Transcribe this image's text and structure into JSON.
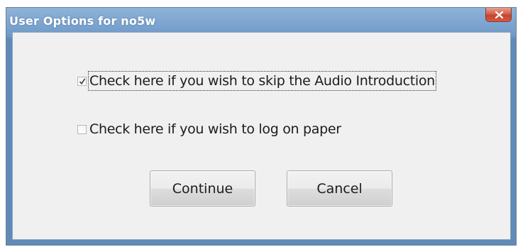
{
  "window": {
    "title": "User Options for no5w"
  },
  "options": [
    {
      "label": "Check here if you wish to skip the Audio Introduction",
      "checked": true
    },
    {
      "label": "Check here if you wish to log on paper",
      "checked": false
    }
  ],
  "buttons": {
    "continue_label": "Continue",
    "cancel_label": "Cancel"
  },
  "icons": {
    "close": "close-icon",
    "check": "checkmark-icon"
  },
  "colors": {
    "titlebar": "#7aa3cf",
    "close_button": "#c7432c",
    "client_background": "#f0f0f0"
  }
}
